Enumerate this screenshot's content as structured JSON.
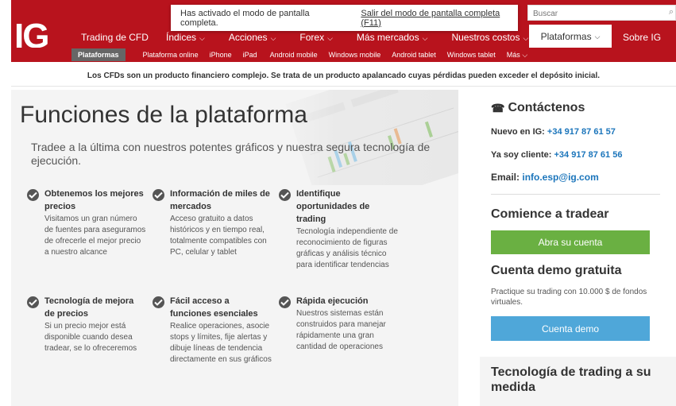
{
  "notice": {
    "message": "Has activado el modo de pantalla completa.",
    "exit_link": "Salir del modo de pantalla completa (F11)"
  },
  "header": {
    "logo": "IG",
    "brand": "Trading de CFD",
    "nav": [
      {
        "label": "Índices"
      },
      {
        "label": "Acciones"
      },
      {
        "label": "Forex"
      },
      {
        "label": "Más mercados"
      },
      {
        "label": "Nuestros costos"
      }
    ],
    "active": "Plataformas",
    "right": "Sobre IG",
    "search_placeholder": "Buscar"
  },
  "subnav": {
    "active": "Plataformas",
    "items": [
      "Plataforma online",
      "iPhone",
      "iPad",
      "Android mobile",
      "Windows mobile",
      "Android tablet",
      "Windows tablet"
    ],
    "more": "Más"
  },
  "disclaimer": "Los CFDs son un producto financiero complejo. Se trata de un producto apalancado cuyas pérdidas pueden exceder el depósito inicial.",
  "hero": {
    "title": "Funciones de la plataforma",
    "subtitle": "Tradee a la última con nuestros potentes gráficos y nuestra segura tecnología de ejecución."
  },
  "features": [
    {
      "title": "Obtenemos los mejores precios",
      "desc": "Visitamos un gran número de fuentes para aseguramos de ofrecerle el mejor precio a nuestro alcance"
    },
    {
      "title": "Información de miles de mercados",
      "desc": "Acceso gratuito a datos históricos y en tiempo real, totalmente compatibles con PC, celular y tablet"
    },
    {
      "title": "Identifique oportunidades de trading",
      "desc": "Tecnología independiente de reconocimiento de figuras gráficas y análisis técnico para identificar tendencias"
    },
    {
      "title": "Tecnología de mejora de precios",
      "desc": "Si un precio mejor está disponible cuando desea tradear, se lo ofreceremos"
    },
    {
      "title": "Fácil acceso a funciones esenciales",
      "desc": "Realice operaciones, asocie stops y límites, fije alertas y dibuje líneas de tendencia directamente en sus gráficos"
    },
    {
      "title": "Rápida ejecución",
      "desc": "Nuestros sistemas están construidos para manejar rápidamente una gran cantidad de operaciones"
    }
  ],
  "sidebar": {
    "contact_title": "Contáctenos",
    "new_label": "Nuevo en IG:",
    "new_phone": "+34 917 87 61 57",
    "client_label": "Ya soy cliente:",
    "client_phone": "+34 917 87 61 56",
    "email_label": "Email:",
    "email": "info.esp@ig.com",
    "start_title": "Comience a tradear",
    "open_account": "Abra su cuenta",
    "demo_title": "Cuenta demo gratuita",
    "demo_desc": "Practique su trading con 10.000 $ de fondos virtuales.",
    "demo_button": "Cuenta demo",
    "tech_title": "Tecnología de trading a su medida"
  },
  "colors": {
    "brand_red": "#b8131d",
    "green": "#6ab042",
    "blue": "#4fa7d9",
    "link": "#1b75bb"
  }
}
